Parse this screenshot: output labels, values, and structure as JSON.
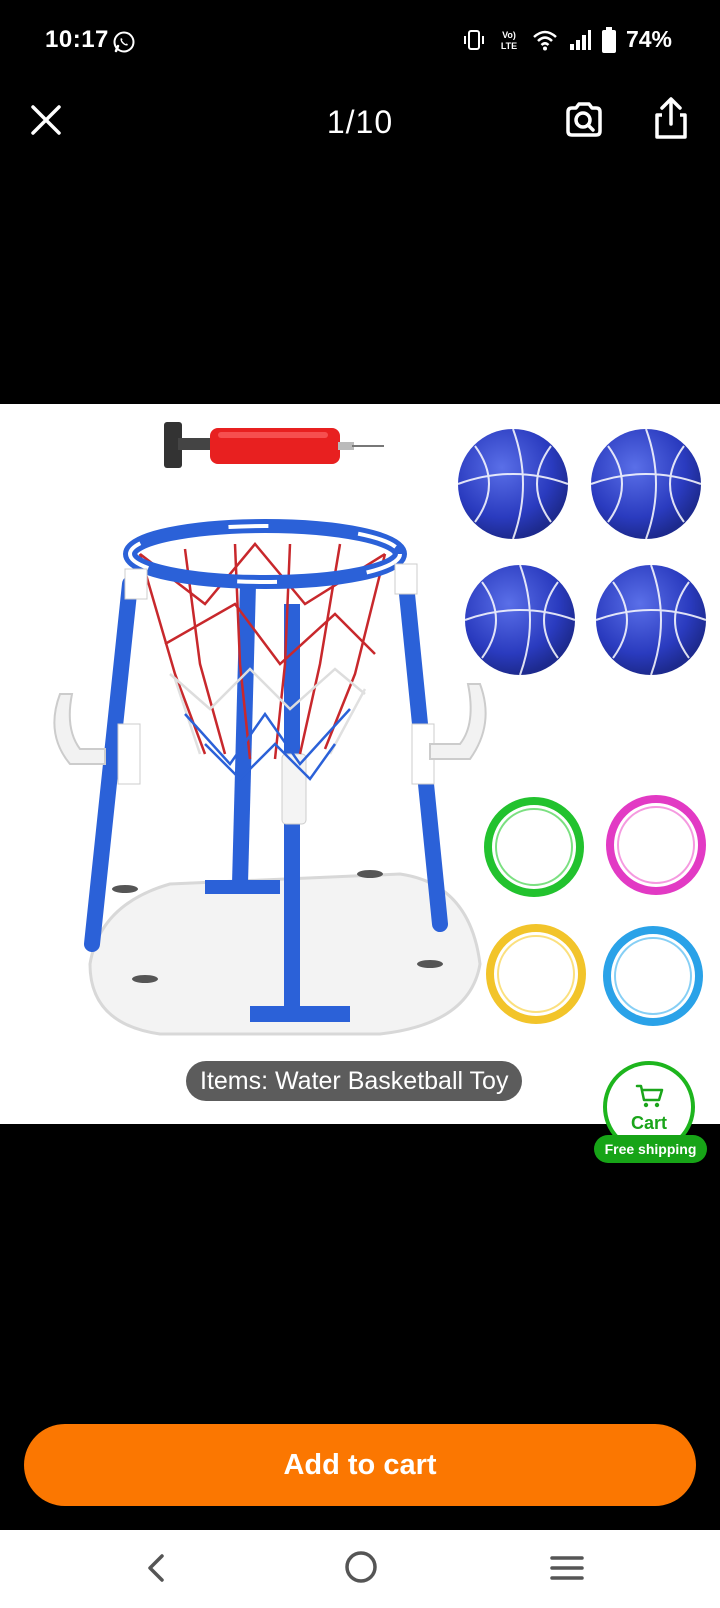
{
  "status_bar": {
    "time": "10:17",
    "battery": "74%",
    "network_label": "Vo) LTE"
  },
  "top_bar": {
    "counter": "1/10"
  },
  "product": {
    "caption": "Items: Water Basketball Toy"
  },
  "cart_widget": {
    "label": "Cart",
    "badge": "Free shipping",
    "accent_color": "#1db51d"
  },
  "actions": {
    "add_to_cart_label": "Add to cart",
    "button_color": "#fb7701"
  },
  "icons": {
    "close": "close-icon",
    "image_search": "camera-search-icon",
    "share": "share-icon",
    "back": "back-icon",
    "home": "home-icon",
    "recents": "recents-icon"
  }
}
